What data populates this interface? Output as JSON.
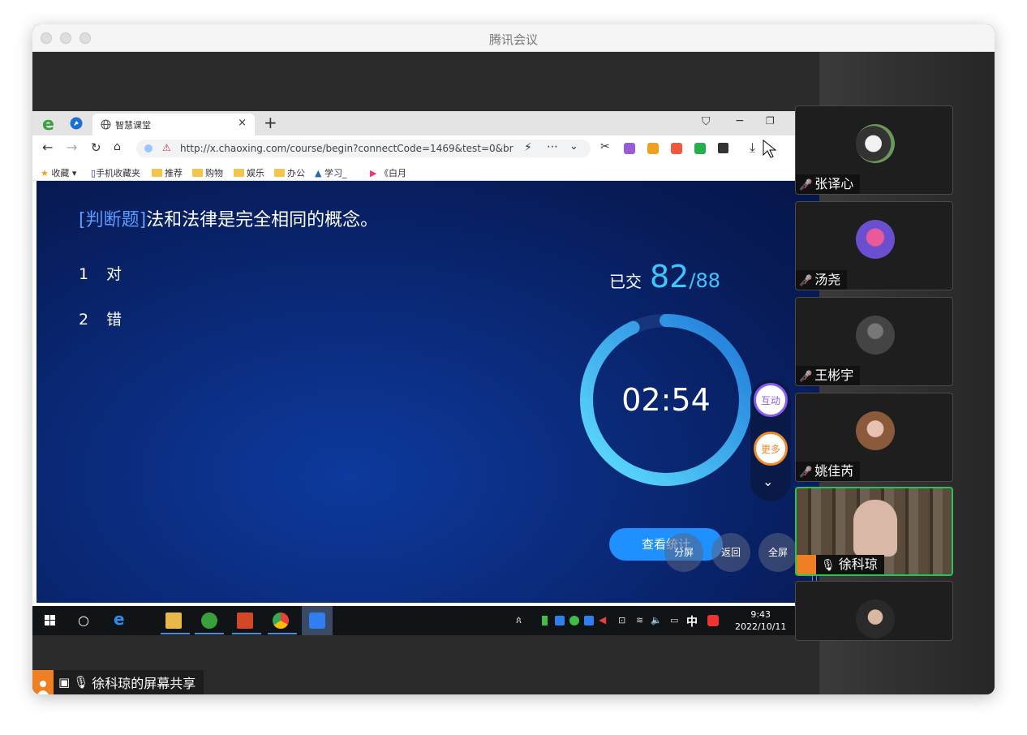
{
  "window": {
    "title": "腾讯会议"
  },
  "browser": {
    "tab_title": "智慧课堂",
    "url": "http://x.chaoxing.com/course/begin?connectCode=1469&test=0&br",
    "bookmarks": [
      "收藏",
      "手机收藏夹",
      "推荐",
      "购物",
      "娱乐",
      "办公",
      "学习_",
      "《白月"
    ]
  },
  "slide": {
    "question_tag": "[判断题]",
    "question_text": "法和法律是完全相同的概念。",
    "options": [
      {
        "num": "1",
        "label": "对"
      },
      {
        "num": "2",
        "label": "错"
      }
    ],
    "submitted_label": "已交",
    "submitted_count": "82",
    "submitted_total": "/88",
    "submitted_fraction": 0.932,
    "timer": "02:54",
    "interact_label": "互动",
    "more_label": "更多",
    "stats_label": "查看统计",
    "split_label": "分屏",
    "back_label": "返回",
    "fullscreen_label": "全屏"
  },
  "taskbar": {
    "time": "9:43",
    "date": "2022/10/11",
    "ime": "中"
  },
  "share": {
    "label": "徐科琼的屏幕共享"
  },
  "participants": [
    {
      "name": "张译心",
      "muted": true
    },
    {
      "name": "汤尧",
      "muted": true
    },
    {
      "name": "王彬宇",
      "muted": true
    },
    {
      "name": "姚佳芮",
      "muted": true
    },
    {
      "name": "徐科琼",
      "muted": false,
      "speaking": true
    },
    {
      "name": "",
      "muted": false
    }
  ],
  "colors": {
    "accent": "#3fc6ff",
    "active_border": "#24c552",
    "brand_orange": "#f07f24"
  }
}
